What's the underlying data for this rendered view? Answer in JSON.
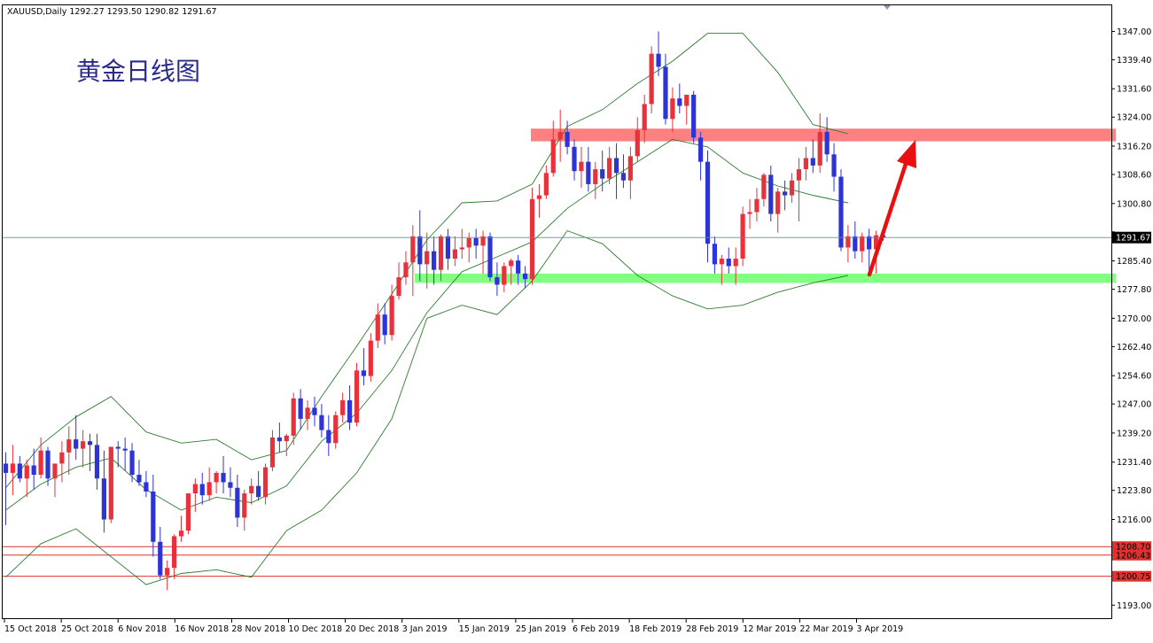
{
  "header": {
    "symbol_info": "XAUUSD,Daily  1292.27 1293.50 1290.82 1291.67"
  },
  "annotation_title": "黄金日线图",
  "chart_data": {
    "type": "candlestick",
    "symbol": "XAUUSD",
    "timeframe": "Daily",
    "ylim": [
      1189.5,
      1354.0
    ],
    "y_ticks": [
      1193.0,
      1200.9,
      1208.7,
      1216.0,
      1223.8,
      1231.4,
      1239.2,
      1247.0,
      1254.6,
      1262.4,
      1270.0,
      1277.8,
      1285.4,
      1293.2,
      1300.8,
      1308.6,
      1316.2,
      1324.0,
      1331.6,
      1339.4,
      1347.0
    ],
    "y_tick_labels": [
      "1193.00",
      "",
      "",
      "1216.00",
      "1223.80",
      "1231.40",
      "1239.20",
      "1247.00",
      "1254.60",
      "1262.40",
      "1270.00",
      "1277.80",
      "1285.40",
      "",
      "1300.80",
      "1308.60",
      "1316.20",
      "1324.00",
      "1331.60",
      "1339.40",
      "1347.00"
    ],
    "x_labels": [
      "15 Oct 2018",
      "25 Oct 2018",
      "6 Nov 2018",
      "16 Nov 2018",
      "28 Nov 2018",
      "10 Dec 2018",
      "20 Dec 2018",
      "3 Jan 2019",
      "15 Jan 2019",
      "25 Jan 2019",
      "6 Feb 2019",
      "18 Feb 2019",
      "28 Feb 2019",
      "12 Mar 2019",
      "22 Mar 2019",
      "3 Apr 2019"
    ],
    "current_price": "1291.67",
    "current_price_value": 1291.67,
    "horizontal_lines": [
      {
        "label": "1208.70",
        "value": 1208.7,
        "color": "#e03030"
      },
      {
        "label": "1206.43",
        "value": 1206.43,
        "color": "#e03030"
      },
      {
        "label": "1200.75",
        "value": 1200.75,
        "color": "#e03030"
      }
    ],
    "zones": [
      {
        "name": "resistance",
        "from": 1317.5,
        "to": 1320.9,
        "color": "#ff8080"
      },
      {
        "name": "support",
        "from": 1279.5,
        "to": 1282.0,
        "color": "#80ff80"
      }
    ],
    "bullish_color": "#e8313a",
    "bearish_color": "#2d34d6",
    "band_color": "#2e7d2e",
    "candles": [
      [
        1231.0,
        1234.0,
        1214.5,
        1228.5
      ],
      [
        1228.5,
        1236.0,
        1222.5,
        1231.0
      ],
      [
        1231.0,
        1233.0,
        1226.0,
        1227.0
      ],
      [
        1227.0,
        1232.0,
        1222.0,
        1230.5
      ],
      [
        1230.5,
        1235.0,
        1224.0,
        1228.0
      ],
      [
        1228.0,
        1238.0,
        1227.0,
        1234.5
      ],
      [
        1234.5,
        1235.5,
        1225.0,
        1227.0
      ],
      [
        1227.0,
        1231.0,
        1222.0,
        1231.0
      ],
      [
        1231.0,
        1237.0,
        1226.0,
        1234.0
      ],
      [
        1234.0,
        1241.0,
        1228.0,
        1237.5
      ],
      [
        1237.5,
        1244.0,
        1232.0,
        1235.0
      ],
      [
        1235.0,
        1240.0,
        1230.0,
        1237.0
      ],
      [
        1237.0,
        1239.0,
        1229.0,
        1236.0
      ],
      [
        1236.0,
        1239.0,
        1224.0,
        1227.0
      ],
      [
        1227.0,
        1234.5,
        1212.5,
        1216.0
      ],
      [
        1216.0,
        1232.0,
        1215.0,
        1235.5
      ],
      [
        1235.5,
        1237.0,
        1230.0,
        1235.0
      ],
      [
        1235.0,
        1238.0,
        1229.0,
        1234.5
      ],
      [
        1234.5,
        1236.5,
        1226.0,
        1228.0
      ],
      [
        1228.0,
        1232.0,
        1225.0,
        1226.0
      ],
      [
        1226.0,
        1229.0,
        1222.0,
        1223.5
      ],
      [
        1223.5,
        1228.0,
        1206.0,
        1210.0
      ],
      [
        1210.0,
        1214.0,
        1200.0,
        1201.0
      ],
      [
        1201.0,
        1205.0,
        1197.0,
        1203.0
      ],
      [
        1203.0,
        1212.0,
        1200.0,
        1211.5
      ],
      [
        1211.5,
        1217.0,
        1210.0,
        1213.0
      ],
      [
        1213.0,
        1222.0,
        1212.0,
        1223.0
      ],
      [
        1223.0,
        1227.0,
        1218.0,
        1225.5
      ],
      [
        1225.5,
        1228.5,
        1220.0,
        1222.5
      ],
      [
        1222.5,
        1230.0,
        1221.0,
        1226.0
      ],
      [
        1226.0,
        1229.0,
        1223.0,
        1228.5
      ],
      [
        1228.5,
        1233.0,
        1223.0,
        1226.0
      ],
      [
        1226.0,
        1230.0,
        1222.0,
        1224.5
      ],
      [
        1224.5,
        1228.0,
        1214.0,
        1216.5
      ],
      [
        1216.5,
        1224.0,
        1213.0,
        1223.0
      ],
      [
        1223.0,
        1227.0,
        1220.0,
        1225.0
      ],
      [
        1225.0,
        1229.0,
        1221.0,
        1222.0
      ],
      [
        1222.0,
        1231.0,
        1220.0,
        1230.0
      ],
      [
        1230.0,
        1240.0,
        1229.0,
        1238.0
      ],
      [
        1238.0,
        1242.0,
        1234.0,
        1237.0
      ],
      [
        1237.0,
        1239.0,
        1233.0,
        1238.5
      ],
      [
        1238.5,
        1250.0,
        1236.0,
        1248.5
      ],
      [
        1248.5,
        1251.0,
        1240.0,
        1243.0
      ],
      [
        1243.0,
        1248.0,
        1240.0,
        1246.0
      ],
      [
        1246.0,
        1249.0,
        1241.0,
        1244.0
      ],
      [
        1244.0,
        1247.0,
        1238.0,
        1240.0
      ],
      [
        1240.0,
        1244.0,
        1233.0,
        1236.5
      ],
      [
        1236.5,
        1245.0,
        1235.0,
        1244.0
      ],
      [
        1244.0,
        1250.0,
        1242.0,
        1248.0
      ],
      [
        1248.0,
        1252.0,
        1240.0,
        1242.0
      ],
      [
        1242.0,
        1258.0,
        1241.0,
        1256.0
      ],
      [
        1256.0,
        1262.0,
        1252.0,
        1254.5
      ],
      [
        1254.5,
        1266.0,
        1253.0,
        1264.0
      ],
      [
        1264.0,
        1274.0,
        1262.0,
        1271.0
      ],
      [
        1271.0,
        1274.0,
        1263.0,
        1265.5
      ],
      [
        1265.5,
        1279.0,
        1264.0,
        1276.0
      ],
      [
        1276.0,
        1285.0,
        1275.0,
        1281.0
      ],
      [
        1281.0,
        1288.0,
        1279.0,
        1285.0
      ],
      [
        1285.0,
        1295.0,
        1276.0,
        1292.0
      ],
      [
        1292.0,
        1299.0,
        1280.0,
        1284.5
      ],
      [
        1284.5,
        1293.0,
        1278.0,
        1288.0
      ],
      [
        1288.0,
        1292.0,
        1279.0,
        1283.0
      ],
      [
        1283.0,
        1292.5,
        1280.0,
        1292.0
      ],
      [
        1292.0,
        1294.0,
        1283.0,
        1286.0
      ],
      [
        1286.0,
        1292.0,
        1284.0,
        1288.5
      ],
      [
        1288.5,
        1294.0,
        1286.0,
        1289.0
      ],
      [
        1289.0,
        1293.0,
        1285.0,
        1291.5
      ],
      [
        1291.5,
        1294.0,
        1286.0,
        1289.5
      ],
      [
        1289.5,
        1293.5,
        1282.0,
        1292.0
      ],
      [
        1292.0,
        1293.0,
        1280.0,
        1281.0
      ],
      [
        1281.0,
        1285.0,
        1276.0,
        1279.0
      ],
      [
        1279.0,
        1285.0,
        1277.0,
        1284.0
      ],
      [
        1284.0,
        1286.0,
        1279.0,
        1285.5
      ],
      [
        1285.5,
        1287.0,
        1279.0,
        1282.0
      ],
      [
        1282.0,
        1284.0,
        1278.0,
        1280.5
      ],
      [
        1280.5,
        1305.0,
        1279.0,
        1302.0
      ],
      [
        1302.0,
        1306.0,
        1297.0,
        1303.0
      ],
      [
        1303.0,
        1311.0,
        1302.0,
        1309.0
      ],
      [
        1309.0,
        1323.0,
        1308.0,
        1318.0
      ],
      [
        1318.0,
        1326.0,
        1312.0,
        1320.0
      ],
      [
        1320.0,
        1323.0,
        1314.0,
        1316.0
      ],
      [
        1316.0,
        1318.0,
        1307.0,
        1309.5
      ],
      [
        1309.5,
        1316.0,
        1305.0,
        1312.0
      ],
      [
        1312.0,
        1316.0,
        1304.0,
        1306.0
      ],
      [
        1306.0,
        1312.0,
        1302.0,
        1310.0
      ],
      [
        1310.0,
        1315.0,
        1304.0,
        1307.5
      ],
      [
        1307.5,
        1316.0,
        1306.0,
        1313.0
      ],
      [
        1313.0,
        1317.0,
        1302.0,
        1309.0
      ],
      [
        1309.0,
        1314.0,
        1305.0,
        1307.0
      ],
      [
        1307.0,
        1316.0,
        1302.0,
        1313.5
      ],
      [
        1313.5,
        1324.0,
        1312.0,
        1320.5
      ],
      [
        1320.5,
        1330.0,
        1317.0,
        1327.5
      ],
      [
        1327.5,
        1343.0,
        1325.0,
        1341.0
      ],
      [
        1341.0,
        1347.0,
        1335.0,
        1337.5
      ],
      [
        1337.5,
        1341.0,
        1322.0,
        1323.5
      ],
      [
        1323.5,
        1332.0,
        1320.0,
        1329.0
      ],
      [
        1329.0,
        1333.0,
        1325.0,
        1327.0
      ],
      [
        1327.0,
        1330.0,
        1322.0,
        1330.0
      ],
      [
        1330.0,
        1331.0,
        1317.0,
        1318.5
      ],
      [
        1318.5,
        1320.0,
        1307.0,
        1312.0
      ],
      [
        1312.0,
        1315.0,
        1285.0,
        1290.0
      ],
      [
        1290.0,
        1292.0,
        1282.0,
        1284.5
      ],
      [
        1284.5,
        1287.0,
        1279.0,
        1286.0
      ],
      [
        1286.0,
        1289.0,
        1282.0,
        1284.0
      ],
      [
        1284.0,
        1289.0,
        1279.0,
        1286.0
      ],
      [
        1286.0,
        1300.0,
        1284.0,
        1298.0
      ],
      [
        1298.0,
        1302.0,
        1294.0,
        1298.5
      ],
      [
        1298.5,
        1305.0,
        1296.0,
        1302.0
      ],
      [
        1302.0,
        1309.0,
        1300.0,
        1308.5
      ],
      [
        1308.5,
        1311.0,
        1296.0,
        1298.0
      ],
      [
        1298.0,
        1305.0,
        1293.0,
        1304.0
      ],
      [
        1304.0,
        1307.0,
        1299.0,
        1303.0
      ],
      [
        1303.0,
        1309.0,
        1301.0,
        1307.0
      ],
      [
        1307.0,
        1313.0,
        1296.0,
        1310.0
      ],
      [
        1310.0,
        1316.0,
        1307.0,
        1313.0
      ],
      [
        1313.0,
        1318.0,
        1309.0,
        1311.0
      ],
      [
        1311.0,
        1325.0,
        1309.0,
        1320.0
      ],
      [
        1320.0,
        1324.0,
        1312.0,
        1314.0
      ],
      [
        1314.0,
        1317.0,
        1304.0,
        1308.0
      ],
      [
        1308.0,
        1310.0,
        1288.0,
        1289.0
      ],
      [
        1289.0,
        1295.0,
        1285.0,
        1292.0
      ],
      [
        1292.0,
        1296.0,
        1286.0,
        1288.0
      ],
      [
        1288.0,
        1293.0,
        1285.0,
        1292.0
      ],
      [
        1292.0,
        1294.0,
        1283.0,
        1288.5
      ],
      [
        1288.5,
        1293.5,
        1282.0,
        1292.27
      ],
      [
        1292.27,
        1293.5,
        1290.82,
        1291.67
      ]
    ],
    "bb_upper": [
      [
        0,
        1224.5
      ],
      [
        5,
        1236.0
      ],
      [
        10,
        1243.5
      ],
      [
        15,
        1249.0
      ],
      [
        20,
        1239.5
      ],
      [
        25,
        1236.5
      ],
      [
        30,
        1237.5
      ],
      [
        35,
        1232.0
      ],
      [
        40,
        1234.5
      ],
      [
        45,
        1249.0
      ],
      [
        50,
        1262.5
      ],
      [
        55,
        1276.5
      ],
      [
        60,
        1291.0
      ],
      [
        65,
        1301.0
      ],
      [
        70,
        1301.5
      ],
      [
        75,
        1306.0
      ],
      [
        80,
        1321.5
      ],
      [
        85,
        1326.0
      ],
      [
        90,
        1333.0
      ],
      [
        95,
        1339.0
      ],
      [
        100,
        1346.5
      ],
      [
        105,
        1346.5
      ],
      [
        110,
        1336.0
      ],
      [
        115,
        1322.0
      ],
      [
        120,
        1319.5
      ]
    ],
    "bb_middle": [
      [
        0,
        1218.5
      ],
      [
        5,
        1225.5
      ],
      [
        10,
        1230.0
      ],
      [
        15,
        1232.5
      ],
      [
        20,
        1224.0
      ],
      [
        25,
        1218.5
      ],
      [
        30,
        1222.0
      ],
      [
        35,
        1220.5
      ],
      [
        40,
        1225.0
      ],
      [
        45,
        1237.0
      ],
      [
        50,
        1244.5
      ],
      [
        55,
        1256.0
      ],
      [
        60,
        1271.5
      ],
      [
        65,
        1282.5
      ],
      [
        70,
        1286.5
      ],
      [
        75,
        1290.5
      ],
      [
        80,
        1299.5
      ],
      [
        85,
        1306.0
      ],
      [
        90,
        1312.0
      ],
      [
        95,
        1318.0
      ],
      [
        100,
        1316.0
      ],
      [
        105,
        1309.0
      ],
      [
        110,
        1305.5
      ],
      [
        115,
        1303.0
      ],
      [
        120,
        1301.0
      ]
    ],
    "bb_lower": [
      [
        0,
        1200.5
      ],
      [
        5,
        1209.5
      ],
      [
        10,
        1213.5
      ],
      [
        15,
        1206.0
      ],
      [
        20,
        1198.5
      ],
      [
        25,
        1201.5
      ],
      [
        30,
        1202.5
      ],
      [
        35,
        1200.5
      ],
      [
        40,
        1213.0
      ],
      [
        45,
        1218.5
      ],
      [
        50,
        1228.5
      ],
      [
        55,
        1243.0
      ],
      [
        60,
        1270.0
      ],
      [
        65,
        1273.5
      ],
      [
        70,
        1271.0
      ],
      [
        75,
        1280.0
      ],
      [
        80,
        1293.5
      ],
      [
        85,
        1290.0
      ],
      [
        90,
        1281.5
      ],
      [
        95,
        1276.0
      ],
      [
        100,
        1272.5
      ],
      [
        105,
        1273.5
      ],
      [
        110,
        1277.0
      ],
      [
        115,
        1279.5
      ],
      [
        120,
        1281.5
      ]
    ]
  }
}
